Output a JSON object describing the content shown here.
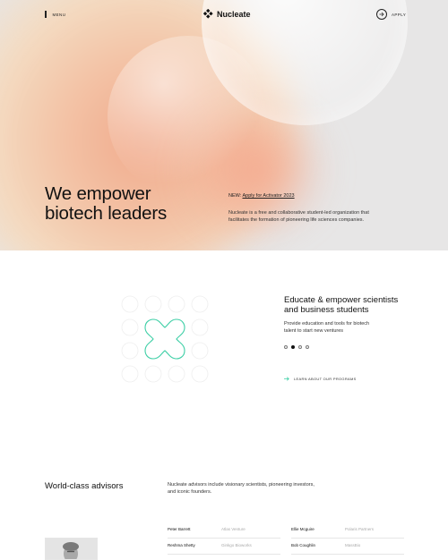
{
  "nav": {
    "menu_label": "MENU",
    "logo_text": "Nucleate",
    "apply_label": "APPLY"
  },
  "hero": {
    "headline_line1": "We empower",
    "headline_line2": "biotech leaders",
    "news_prefix": "NEW:",
    "news_link": "Apply for Activator 2023",
    "description": "Nucleate is a free and collaborative student-led organization that facilitates the formation of pioneering life sciences companies."
  },
  "programs": {
    "title": "Educate & empower scientists and business students",
    "description": "Provide education and tools for biotech talent to start new ventures",
    "carousel_active_index": 1,
    "learn_more_label": "LEARN ABOUT OUR PROGRAMS",
    "accent_color": "#3ecfa6"
  },
  "advisors": {
    "title": "World-class advisors",
    "description": "Nucleate advisors include visionary scientists, pioneering investors, and iconic founders.",
    "rows": [
      {
        "left_name": "Peter Barrett",
        "left_org": "Atlas Venture",
        "right_name": "Ellie Mcguire",
        "right_org": "Polaris Partners"
      },
      {
        "left_name": "Reshma Shetty",
        "left_org": "Ginkgo Bioworks",
        "right_name": "Bob Coughlin",
        "right_org": "MassBio"
      }
    ]
  }
}
